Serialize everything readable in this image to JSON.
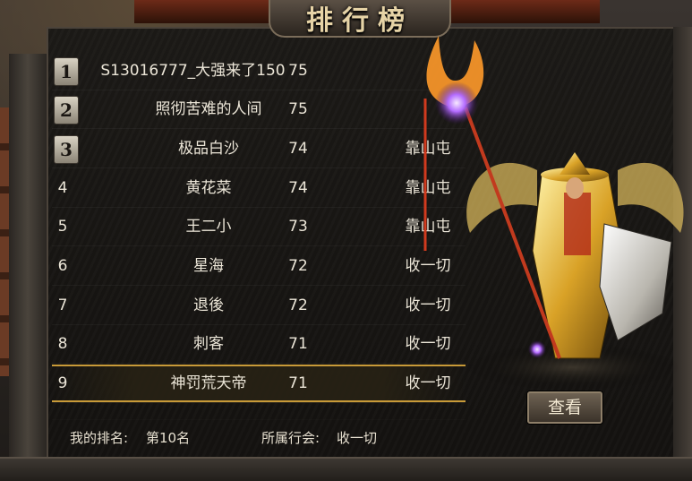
{
  "title": "排行榜",
  "rankings": [
    {
      "rank": "1",
      "name": "S13016777_大强来了150",
      "level": "75",
      "guild": ""
    },
    {
      "rank": "2",
      "name": "照彻苦难的人间",
      "level": "75",
      "guild": ""
    },
    {
      "rank": "3",
      "name": "极品白沙",
      "level": "74",
      "guild": "靠山屯"
    },
    {
      "rank": "4",
      "name": "黄花菜",
      "level": "74",
      "guild": "靠山屯"
    },
    {
      "rank": "5",
      "name": "王二小",
      "level": "73",
      "guild": "靠山屯"
    },
    {
      "rank": "6",
      "name": "星海",
      "level": "72",
      "guild": "收一切"
    },
    {
      "rank": "7",
      "name": "退後",
      "level": "72",
      "guild": "收一切"
    },
    {
      "rank": "8",
      "name": "刺客",
      "level": "71",
      "guild": "收一切"
    },
    {
      "rank": "9",
      "name": "神罚荒天帝",
      "level": "71",
      "guild": "收一切"
    }
  ],
  "footer": {
    "my_rank_label": "我的排名:",
    "my_rank_value": "第10名",
    "guild_label": "所属行会:",
    "guild_value": "收一切"
  },
  "view_button": "查看",
  "colors": {
    "highlight_gold": "#c89a38",
    "text": "#ece6d8"
  }
}
